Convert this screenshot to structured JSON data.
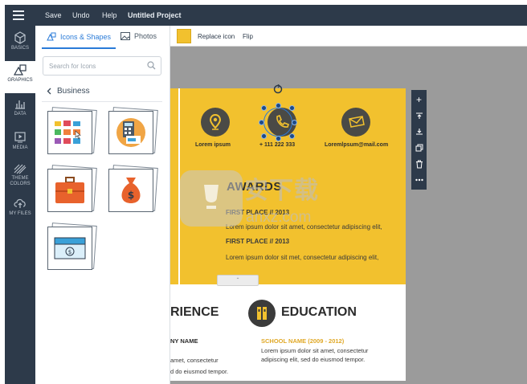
{
  "topbar": {
    "menu": [
      "Save",
      "Undo",
      "Help"
    ],
    "project_title": "Untitled Project"
  },
  "rail": [
    {
      "label": "BASICS",
      "icon": "cube-icon"
    },
    {
      "label": "GRAPHICS",
      "icon": "shapes-icon"
    },
    {
      "label": "DATA",
      "icon": "chart-icon"
    },
    {
      "label": "MEDIA",
      "icon": "play-icon"
    },
    {
      "label": "THEME\nCOLORS",
      "icon": "stripes-icon"
    },
    {
      "label": "MY FILES",
      "icon": "cloud-upload-icon"
    }
  ],
  "panel": {
    "tabs": [
      "Icons & Shapes",
      "Photos"
    ],
    "search_placeholder": "Search for Icons",
    "category": "Business"
  },
  "toolbar": {
    "color": "#F2C12E",
    "replace_icon": "Replace icon",
    "flip": "Flip"
  },
  "page": {
    "contacts": [
      "Lorem ipsum",
      "+ 111 222 333",
      "Loremlpsum@mail.com"
    ],
    "awards_title": "AWARDS",
    "first_place_1": "FIRST PLACE // 2013",
    "award_text_1": "Lorem ipsum dolor sit amet, consectetur adipiscing elit,",
    "first_place_2": "FIRST PLACE // 2013",
    "award_text_2": "Lorem ipsum dolor sit met, consectetur adipiscing elit,",
    "experience_title": "RIENCE",
    "company": "NY NAME",
    "exp_text_1": "amet, consectetur",
    "exp_text_2": "d do eiusmod tempor.",
    "education_title": "EDUCATION",
    "school": "SCHOOL NAME (2009 - 2012)",
    "edu_text_1": "Lorem ipsum dolor sit amet, consectetur",
    "edu_text_2": "adipiscing elit, sed do eiusmod tempor."
  },
  "watermark": {
    "text": "安下载",
    "url": "anxz.com"
  },
  "colors": {
    "dark": "#2D3A4A",
    "accent": "#2A7BD8",
    "yellow": "#F2C12E",
    "school": "#E0A826"
  }
}
